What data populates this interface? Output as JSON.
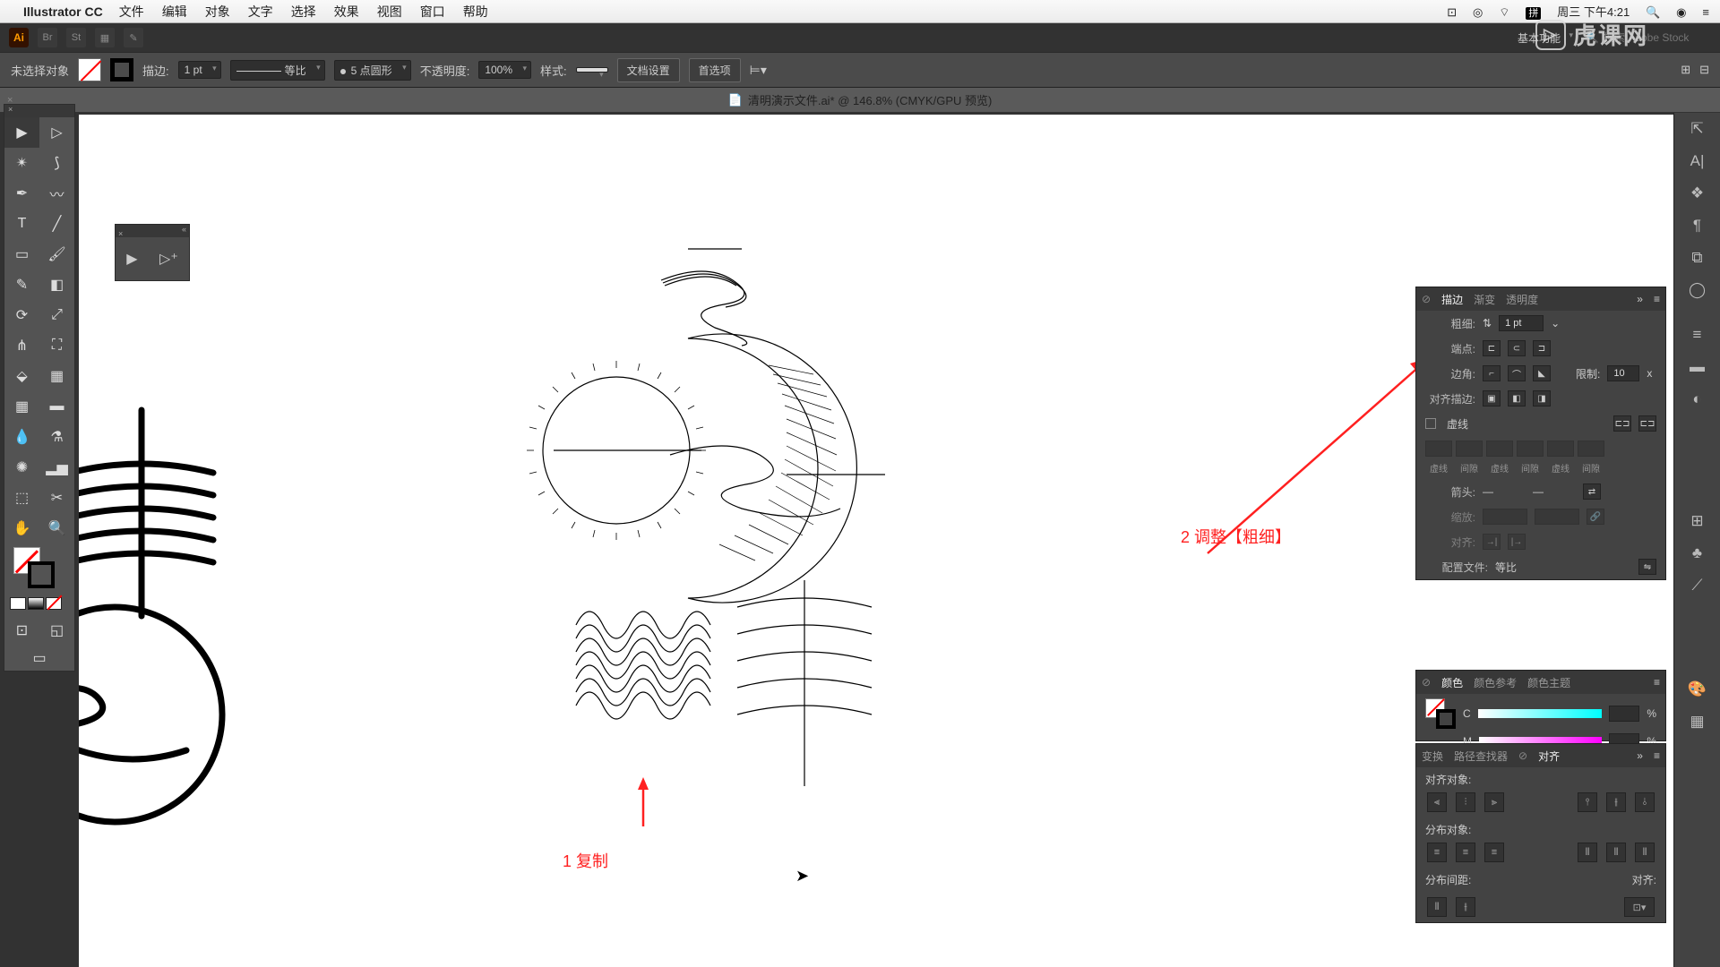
{
  "menubar": {
    "app": "Illustrator CC",
    "items": [
      "文件",
      "编辑",
      "对象",
      "文字",
      "选择",
      "效果",
      "视图",
      "窗口",
      "帮助"
    ],
    "ime": "拼",
    "day": "周三 下午4:21"
  },
  "toprow": {
    "workspace": "基本功能",
    "search_ph": "搜索 Adobe Stock"
  },
  "ctrl": {
    "noselect": "未选择对象",
    "stroke_lbl": "描边:",
    "stroke_w": "1 pt",
    "profile": "等比",
    "brush": "5 点圆形",
    "opacity_lbl": "不透明度:",
    "opacity": "100%",
    "style_lbl": "样式:",
    "docsetup": "文档设置",
    "prefs": "首选项"
  },
  "tab": {
    "title": "清明演示文件.ai* @ 146.8% (CMYK/GPU 预览)"
  },
  "stroke_panel": {
    "tabs": [
      "描边",
      "渐变",
      "透明度"
    ],
    "weight_lbl": "粗细:",
    "weight": "1 pt",
    "cap_lbl": "端点:",
    "corner_lbl": "边角:",
    "limit_lbl": "限制:",
    "limit": "10",
    "align_lbl": "对齐描边:",
    "dashed_lbl": "虚线",
    "dash_labels": [
      "虚线",
      "间隙",
      "虚线",
      "间隙",
      "虚线",
      "间隙"
    ],
    "arrow_lbl": "箭头:",
    "scale_lbl": "缩放:",
    "align2_lbl": "对齐:",
    "profile_lbl": "配置文件:",
    "profile": "等比"
  },
  "color_panel": {
    "tabs": [
      "颜色",
      "颜色参考",
      "颜色主题"
    ],
    "c": "C",
    "m": "M",
    "pct": "%"
  },
  "align_panel": {
    "tabs": [
      "变换",
      "路径查找器",
      "对齐"
    ],
    "align_obj": "对齐对象:",
    "dist_obj": "分布对象:",
    "dist_gap": "分布间距:",
    "align_to": "对齐:"
  },
  "anno": {
    "copy": "1 复制",
    "adjust": "2 调整【粗细】"
  },
  "watermark": "虎课网"
}
